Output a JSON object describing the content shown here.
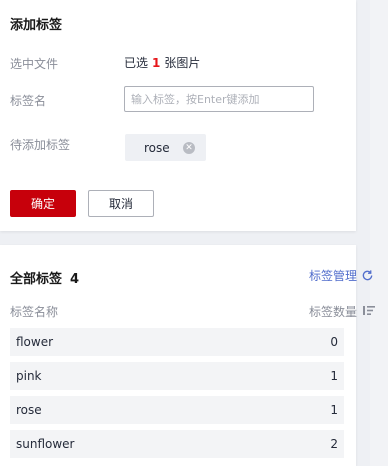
{
  "add_tag": {
    "title": "添加标签",
    "selected_label": "选中文件",
    "selected_prefix": "已选",
    "selected_count": "1",
    "selected_suffix": "张图片",
    "tag_name_label": "标签名",
    "tag_input_placeholder": "输入标签，按Enter键添加",
    "tag_input_value": "",
    "pending_label": "待添加标签",
    "pending_tags": [
      {
        "name": "rose"
      }
    ],
    "confirm_label": "确定",
    "cancel_label": "取消"
  },
  "all_tags": {
    "title": "全部标签",
    "count": "4",
    "manage_label": "标签管理",
    "col_name": "标签名称",
    "col_count": "标签数量",
    "rows": [
      {
        "name": "flower",
        "count": "0"
      },
      {
        "name": "pink",
        "count": "1"
      },
      {
        "name": "rose",
        "count": "1"
      },
      {
        "name": "sunflower",
        "count": "2"
      }
    ]
  },
  "colors": {
    "primary": "#c7000b",
    "link": "#526ecc",
    "count_highlight": "#e6161a"
  },
  "icons": {
    "chip_close": "close-circle-icon",
    "manage": "refresh-icon",
    "sort": "sort-icon"
  }
}
